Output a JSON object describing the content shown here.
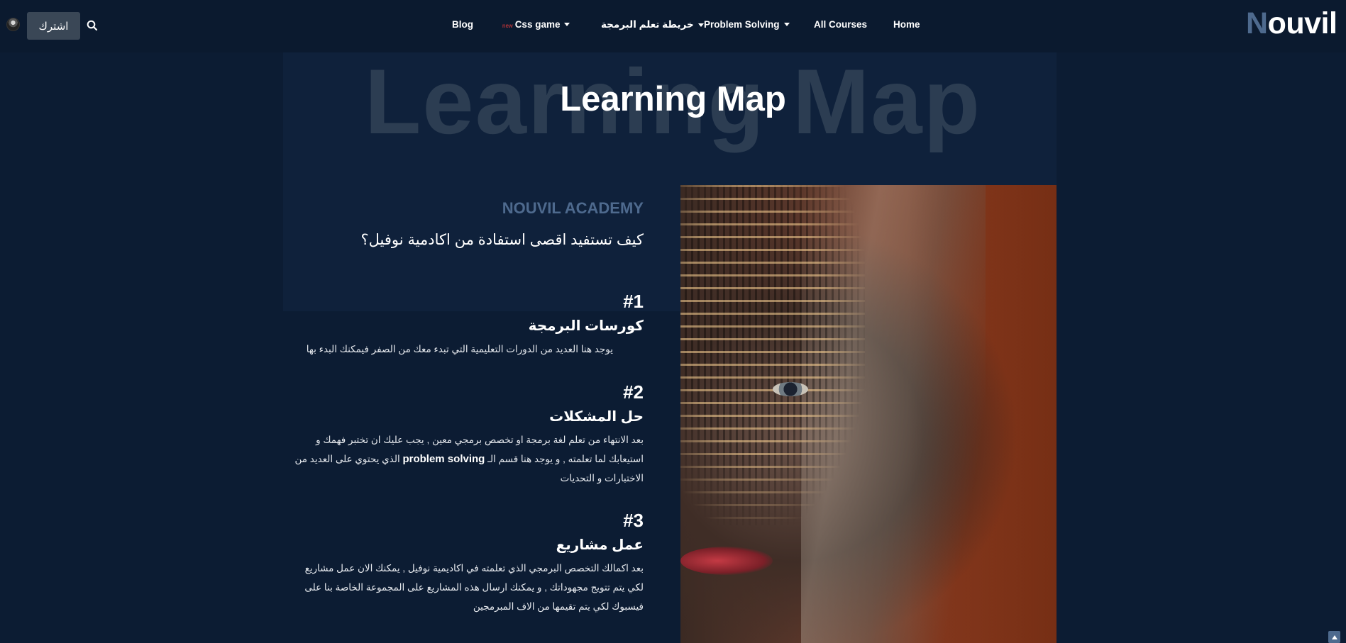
{
  "nav": {
    "subscribe_label": "اشترك",
    "items": [
      {
        "label": "Blog",
        "has_dropdown": false
      },
      {
        "label": "Css game",
        "badge": "new",
        "has_dropdown": true
      },
      {
        "label": "خريطة تعلم البرمجة",
        "has_dropdown": true
      },
      {
        "label": "Problem Solving",
        "has_dropdown": true
      },
      {
        "label": "All Courses",
        "has_dropdown": false
      },
      {
        "label": "Home",
        "has_dropdown": false
      }
    ],
    "logo_first": "N",
    "logo_rest": "ouvil"
  },
  "hero": {
    "bg_text": "Learning Map",
    "title": "Learning Map"
  },
  "content": {
    "academy_label": "NOUVIL ACADEMY",
    "question": "كيف تستفيد اقصى استفادة من اكادمية نوفيل؟",
    "steps": [
      {
        "num": "#1",
        "title": "كورسات البرمجة",
        "text": "يوجد هنا العديد من الدورات التعليمية التي تبدء معك من الصفر فيمكنك البدء بها"
      },
      {
        "num": "#2",
        "title": "حل المشكلات",
        "text_before": "بعد الانتهاء من تعلم لغة برمجة او تخصص برمجي معين , يجب عليك ان تختبر فهمك و استيعابك لما تعلمته , و يوجد هنا قسم الـ",
        "text_strong": "problem solving",
        "text_after": "الذي يحتوي على العديد من الاختبارات و التحديات"
      },
      {
        "num": "#3",
        "title": "عمل مشاريع",
        "text": "بعد اكمالك التخصص البرمجي الذي تعلمته في اكاديمية نوفيل , يمكنك الان عمل مشاريع لكي يتم تتويج مجهوداتك , و يمكنك ارسال هذه المشاريع على المجموعة الخاصة بنا على فيسبوك لكي يتم تقيمها من الاف المبرمجين"
      }
    ]
  },
  "colors": {
    "background": "#0c1c33",
    "navbar": "#0b1a2f",
    "accent": "#4e6a8e",
    "badge_new": "#e23a3a"
  },
  "icons": {
    "search": "search-icon",
    "avatar": "avatar",
    "scroll_top": "arrow-up-icon",
    "dropdown": "caret-down-icon"
  }
}
